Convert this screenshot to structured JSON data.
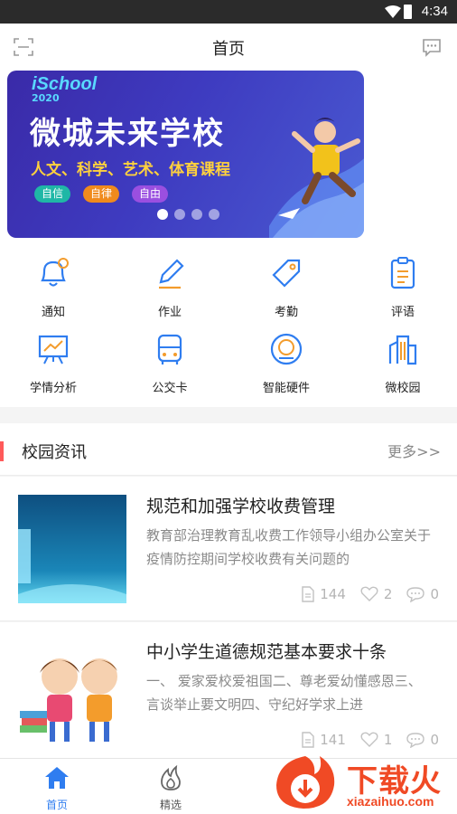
{
  "status_bar": {
    "time": "4:34"
  },
  "header": {
    "title": "首页",
    "scan_icon": "scan-icon",
    "message_icon": "message-icon"
  },
  "banner": {
    "logo": "iSchool",
    "year": "2020",
    "headline": "微城未来学校",
    "subline": "人文、科学、艺术、体育课程",
    "tags": [
      "自信",
      "自律",
      "自由"
    ],
    "slide_count": 4,
    "active_slide": 1
  },
  "quick_grid": [
    {
      "label": "通知",
      "icon": "bell-icon"
    },
    {
      "label": "作业",
      "icon": "pencil-icon"
    },
    {
      "label": "考勤",
      "icon": "tag-icon"
    },
    {
      "label": "评语",
      "icon": "clipboard-icon"
    },
    {
      "label": "学情分析",
      "icon": "chart-board-icon"
    },
    {
      "label": "公交卡",
      "icon": "bus-icon"
    },
    {
      "label": "智能硬件",
      "icon": "device-icon"
    },
    {
      "label": "微校园",
      "icon": "building-icon"
    }
  ],
  "news": {
    "section_title": "校园资讯",
    "more_label": "更多>>",
    "items": [
      {
        "title": "规范和加强学校收费管理",
        "summary": "教育部治理教育乱收费工作领导小组办公室关于疫情防控期间学校收费有关问题的",
        "views": "144",
        "likes": "2",
        "comments": "0"
      },
      {
        "title": "中小学生道德规范基本要求十条",
        "summary": "一、 爱家爱校爱祖国二、尊老爱幼懂感恩三、言谈举止要文明四、守纪好学求上进",
        "views": "141",
        "likes": "1",
        "comments": "0"
      }
    ]
  },
  "tab_bar": {
    "tabs": [
      {
        "label": "首页",
        "icon": "home-icon",
        "active": true
      },
      {
        "label": "精选",
        "icon": "flame-icon",
        "active": false
      }
    ]
  },
  "watermark": {
    "title": "下载火",
    "url": "xiazaihuo.com"
  },
  "colors": {
    "accent": "#2f7df0",
    "section_bar": "#ff5a5a",
    "watermark": "#f04a25"
  }
}
